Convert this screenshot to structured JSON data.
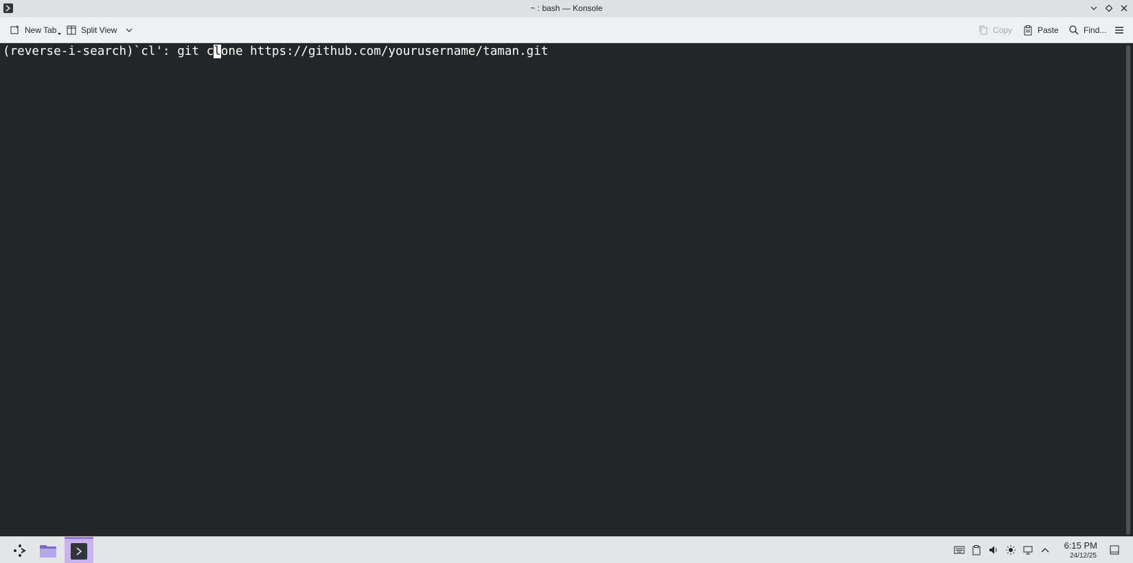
{
  "window": {
    "title": "~ : bash — Konsole"
  },
  "toolbar": {
    "new_tab_label": "New Tab",
    "split_view_label": "Split View",
    "copy_label": "Copy",
    "paste_label": "Paste",
    "find_label": "Find..."
  },
  "terminal": {
    "prefix": "(reverse-i-search)`cl': git c",
    "cursor_char": "l",
    "suffix": "one https://github.com/yourusername/taman.git"
  },
  "taskbar": {
    "clock_time": "6:15 PM",
    "clock_date": "24/12/25",
    "items": [
      "application-launcher-icon",
      "file-manager-icon",
      "konsole-icon"
    ]
  },
  "colors": {
    "terminal_bg": "#232627",
    "terminal_fg": "#fcfcfc",
    "active_task_bg": "#c9b3ee"
  }
}
